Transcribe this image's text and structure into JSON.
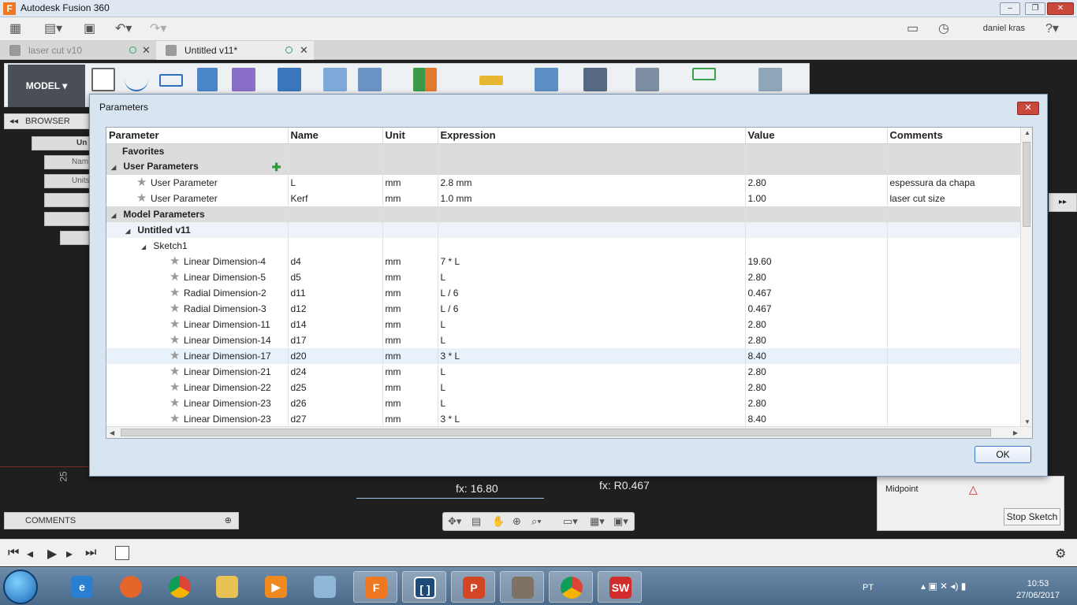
{
  "app": {
    "title": "Autodesk Fusion 360",
    "logo_letter": "F"
  },
  "qat": {
    "user": "daniel kras"
  },
  "tabs": [
    {
      "label": "laser cut v10"
    },
    {
      "label": "Untitled v11*"
    }
  ],
  "workspace": {
    "model_label": "MODEL"
  },
  "browser": {
    "label": "BROWSER",
    "node1": "Un",
    "node2": "Nam",
    "node3": "Units"
  },
  "canvas": {
    "dim1": "fx: 16.80",
    "dim2": "fx: R0.467",
    "axis": "25"
  },
  "sketch_palette": {
    "midpoint": "Midpoint",
    "stop_sketch": "Stop Sketch"
  },
  "comments": {
    "label": "COMMENTS"
  },
  "dialog": {
    "title": "Parameters",
    "ok": "OK",
    "columns": [
      "Parameter",
      "Name",
      "Unit",
      "Expression",
      "Value",
      "Comments"
    ],
    "favorites": "Favorites",
    "user_parameters": "User Parameters",
    "user_rows": [
      {
        "param": "User Parameter",
        "name": "L",
        "unit": "mm",
        "expression": "2.8 mm",
        "value": "2.80",
        "comment": "espessura da chapa"
      },
      {
        "param": "User Parameter",
        "name": "Kerf",
        "unit": "mm",
        "expression": "1.0 mm",
        "value": "1.00",
        "comment": "laser cut size"
      }
    ],
    "model_parameters": "Model Parameters",
    "component": "Untitled v11",
    "sketch": "Sketch1",
    "model_rows": [
      {
        "param": "Linear Dimension-4",
        "name": "d4",
        "unit": "mm",
        "expression": "7 * L",
        "value": "19.60"
      },
      {
        "param": "Linear Dimension-5",
        "name": "d5",
        "unit": "mm",
        "expression": "L",
        "value": "2.80"
      },
      {
        "param": "Radial Dimension-2",
        "name": "d11",
        "unit": "mm",
        "expression": "L / 6",
        "value": "0.467"
      },
      {
        "param": "Radial Dimension-3",
        "name": "d12",
        "unit": "mm",
        "expression": "L / 6",
        "value": "0.467"
      },
      {
        "param": "Linear Dimension-11",
        "name": "d14",
        "unit": "mm",
        "expression": "L",
        "value": "2.80"
      },
      {
        "param": "Linear Dimension-14",
        "name": "d17",
        "unit": "mm",
        "expression": "L",
        "value": "2.80"
      },
      {
        "param": "Linear Dimension-17",
        "name": "d20",
        "unit": "mm",
        "expression": "3 * L",
        "value": "8.40"
      },
      {
        "param": "Linear Dimension-21",
        "name": "d24",
        "unit": "mm",
        "expression": "L",
        "value": "2.80"
      },
      {
        "param": "Linear Dimension-22",
        "name": "d25",
        "unit": "mm",
        "expression": "L",
        "value": "2.80"
      },
      {
        "param": "Linear Dimension-23",
        "name": "d26",
        "unit": "mm",
        "expression": "L",
        "value": "2.80"
      },
      {
        "param": "Linear Dimension-23",
        "name": "d27",
        "unit": "mm",
        "expression": "3 * L",
        "value": "8.40"
      }
    ]
  },
  "taskbar": {
    "lang": "PT",
    "time": "10:53",
    "date": "27/06/2017"
  },
  "colors": {
    "accent": "#f07820",
    "dialog_bg": "#d9e4f1",
    "group_row": "#dcdcdc",
    "ok_border": "#3b78c9"
  }
}
